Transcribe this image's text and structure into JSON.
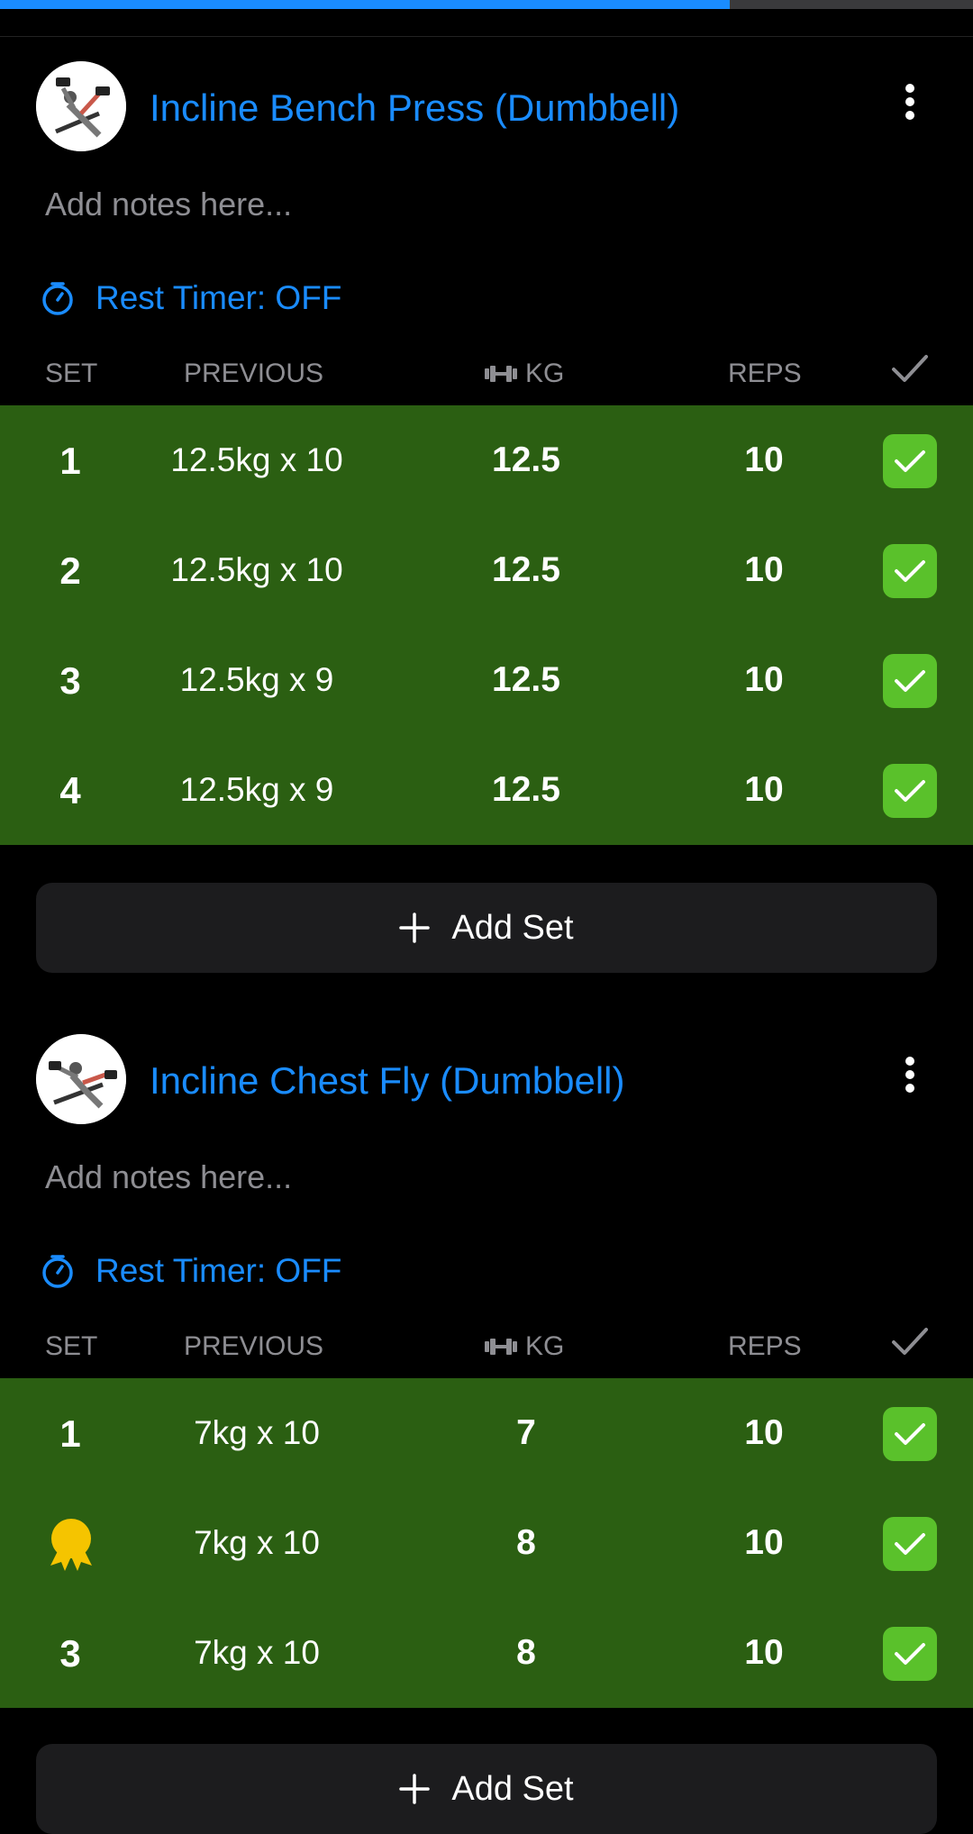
{
  "workout_progress": 0.75,
  "colors": {
    "accent": "#1a8cff",
    "completed_row": "#2b5f12",
    "check_green": "#5ac12b",
    "medal_gold": "#f5c400"
  },
  "columns": {
    "set": "SET",
    "previous": "PREVIOUS",
    "kg": "KG",
    "reps": "REPS",
    "kg_icon": "dumbbell-icon",
    "done_icon": "checkmark-icon"
  },
  "exercises": [
    {
      "title": "Incline Bench Press (Dumbbell)",
      "notes_placeholder": "Add notes here...",
      "rest_timer": "Rest Timer: OFF",
      "add_set_label": "Add Set",
      "sets": [
        {
          "set": "1",
          "previous": "12.5kg x 10",
          "kg": "12.5",
          "reps": "10",
          "done": true
        },
        {
          "set": "2",
          "previous": "12.5kg x 10",
          "kg": "12.5",
          "reps": "10",
          "done": true
        },
        {
          "set": "3",
          "previous": "12.5kg x 9",
          "kg": "12.5",
          "reps": "10",
          "done": true
        },
        {
          "set": "4",
          "previous": "12.5kg x 9",
          "kg": "12.5",
          "reps": "10",
          "done": true
        }
      ]
    },
    {
      "title": "Incline Chest Fly (Dumbbell)",
      "notes_placeholder": "Add notes here...",
      "rest_timer": "Rest Timer: OFF",
      "add_set_label": "Add Set",
      "sets": [
        {
          "set": "1",
          "previous": "7kg x 10",
          "kg": "7",
          "reps": "10",
          "done": true
        },
        {
          "set": "",
          "badge": "medal-icon",
          "previous": "7kg x 10",
          "kg": "8",
          "reps": "10",
          "done": true
        },
        {
          "set": "3",
          "previous": "7kg x 10",
          "kg": "8",
          "reps": "10",
          "done": true
        }
      ]
    }
  ]
}
